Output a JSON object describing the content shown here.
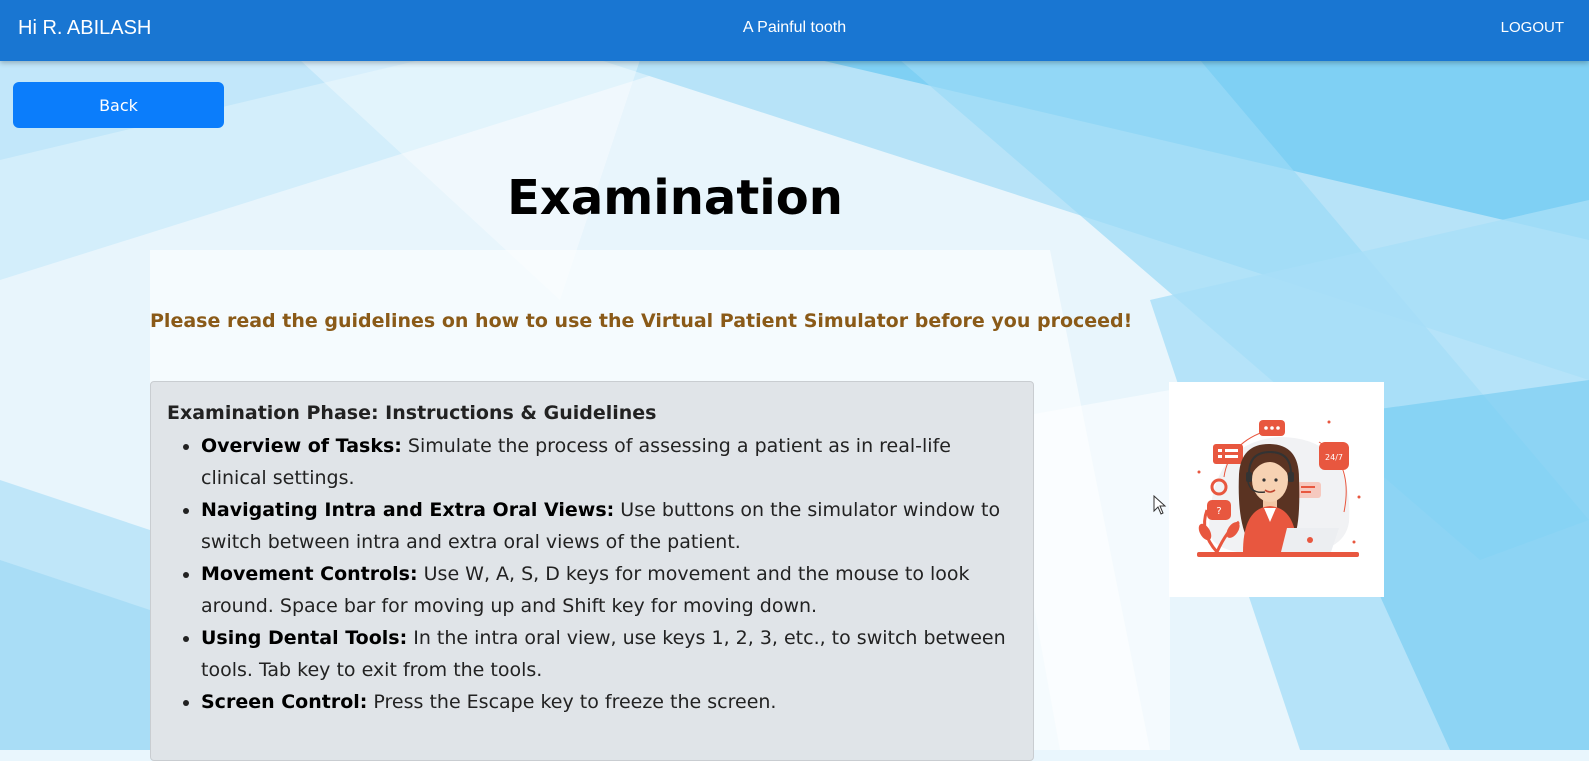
{
  "header": {
    "greeting": "Hi R. ABILASH",
    "case_title": "A Painful tooth",
    "logout_label": "LOGOUT"
  },
  "actions": {
    "back_label": "Back"
  },
  "main": {
    "title": "Examination",
    "notice": "Please read the guidelines on how to use the Virtual Patient Simulator before you proceed!",
    "guidelines": {
      "heading": "Examination Phase: Instructions & Guidelines",
      "items": [
        {
          "label": "Overview of Tasks:",
          "text": " Simulate the process of assessing a patient as in real-life clinical settings."
        },
        {
          "label": "Navigating Intra and Extra Oral Views:",
          "text": " Use buttons on the simulator window to switch between intra and extra oral views of the patient."
        },
        {
          "label": "Movement Controls:",
          "text": " Use W, A, S, D keys for movement and the mouse to look around. Space bar for moving up and Shift key for moving down."
        },
        {
          "label": "Using Dental Tools:",
          "text": " In the intra oral view, use keys 1, 2, 3, etc., to switch between tools. Tab key to exit from the tools."
        },
        {
          "label": "Screen Control:",
          "text": " Press the Escape key to freeze the screen."
        }
      ]
    },
    "illustration": {
      "badge_text": "24/7",
      "icon": "support-agent-illustration"
    }
  },
  "colors": {
    "header": "#1976d2",
    "back_button": "#0b7dfb",
    "notice_text": "#8a5a18",
    "guideline_box": "#dee2e6",
    "illustration_accent": "#e8573f"
  }
}
